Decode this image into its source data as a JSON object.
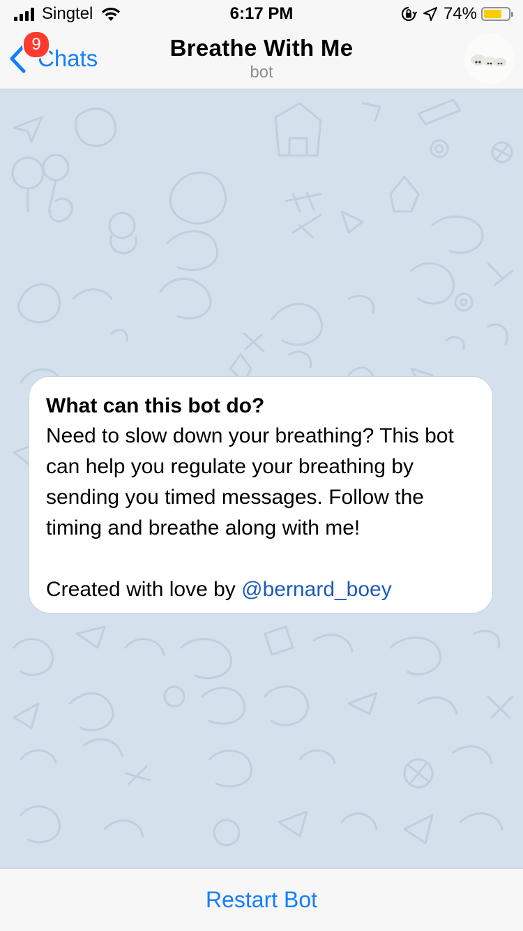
{
  "status_bar": {
    "carrier": "Singtel",
    "time": "6:17 PM",
    "battery_percent": "74%",
    "battery_level": 0.74,
    "icons": [
      "signal-icon",
      "wifi-icon",
      "orientation-lock-icon",
      "location-arrow-icon",
      "battery-icon"
    ]
  },
  "nav": {
    "back_label": "Chats",
    "unread_count": "9",
    "title": "Breathe With Me",
    "subtitle": "bot"
  },
  "card": {
    "heading": "What can this bot do?",
    "body": "Need to slow down your breathing? This bot can help you regulate your breathing by sending you timed messages. Follow the timing and breathe along with me!",
    "credit_prefix": "Created with love by ",
    "mention": "@bernard_boey"
  },
  "bottom": {
    "button_label": "Restart Bot"
  },
  "colors": {
    "accent": "#167efb",
    "chat_background": "#d4e0ec",
    "badge": "#ff3b30",
    "mention": "#1c5bb5",
    "battery": "#ffcc00"
  }
}
